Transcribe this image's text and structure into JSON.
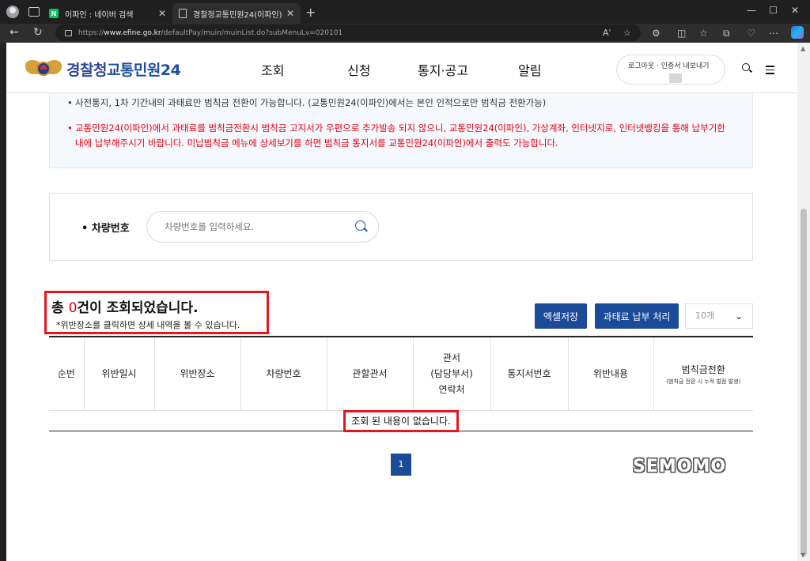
{
  "browser": {
    "tabs": [
      {
        "title": "이파인 : 네이버 검색"
      },
      {
        "title": "경찰청교통민원24(이파인)"
      }
    ],
    "url_prefix": "https://",
    "url_host": "www.efine.go.kr",
    "url_path": "/defaultPay/muin/muinList.do?subMenuLv=020101",
    "read_aloud": "Aʾ"
  },
  "header": {
    "logo_org": "경찰청",
    "logo_service": "교통민원24",
    "menu": [
      "조회",
      "신청",
      "통지·공고",
      "알림"
    ],
    "login_links": "로그아웃 · 인증서 내보내기"
  },
  "notice": {
    "line1": "사전통지, 1차 기간내의 과태료만 범칙금 전환이 가능합니다. (교통민원24(이파인)에서는 본인 인적으로만 범칙금 전환가능)",
    "line2": "교통민원24(이파인)에서 과태료를 범칙금전환시 범칙금 고지서가 우편으로 추가발송 되지 않으니, 교통민원24(이파인), 가상계좌, 인터넷지로, 인터넷뱅킹을 통해 납부기한내에 납부해주시기 바랍니다. 미납범칙금 메뉴에 상세보기를 하면 범칙금 통지서를 교통민원24(이파인)에서 출력도 가능합니다."
  },
  "search": {
    "label": "차량번호",
    "placeholder": "차량번호를 입력하세요."
  },
  "results": {
    "prefix": "총 ",
    "count": "0",
    "suffix": "건이 조회되었습니다.",
    "hint": "*위반장소를 클릭하면 상세 내역을 볼 수 있습니다.",
    "excel_button": "엑셀저장",
    "pay_button": "과태료 납부 처리",
    "page_size": "10개"
  },
  "table": {
    "headers": [
      "순번",
      "위반일시",
      "위반장소",
      "차량번호",
      "관할관서",
      "관서\n(담당부서)\n연락처",
      "통지서번호",
      "위반내용",
      "범칙금전환"
    ],
    "header_note": "(범칙금 전환 시 누적 벌점 발생)",
    "empty_message": "조회 된 내용이 없습니다."
  },
  "pagination": {
    "current": "1"
  },
  "watermark": "SEMOMO",
  "colors": {
    "accent": "#1b4a99",
    "alert": "#e60012",
    "highlight_box": "#e8141e"
  }
}
